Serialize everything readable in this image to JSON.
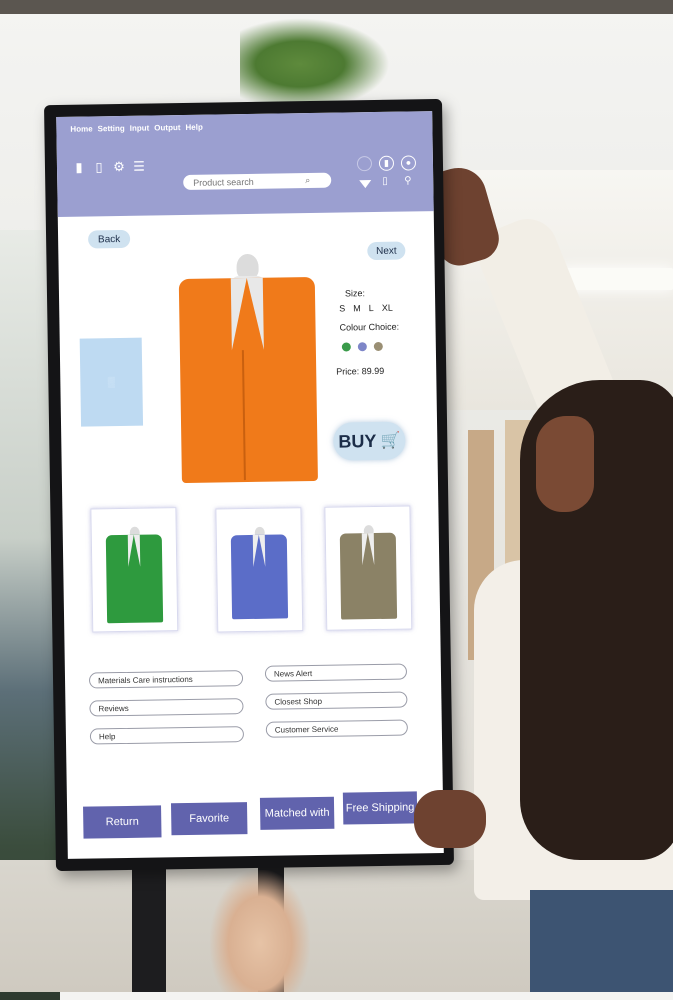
{
  "menu": [
    "Home",
    "Setting",
    "Input",
    "Output",
    "Help"
  ],
  "search": {
    "placeholder": "Product search",
    "icon": "search-icon"
  },
  "nav": {
    "back": "Back",
    "next": "Next"
  },
  "product": {
    "size_label": "Size:",
    "sizes": [
      "S",
      "M",
      "L",
      "XL"
    ],
    "colour_label": "Colour Choice:",
    "colours": [
      "#3a9b4a",
      "#7e86c8",
      "#9a8f74"
    ],
    "price": "Price: 89.99",
    "buy_label": "BUY",
    "main_color": "#f07a1a"
  },
  "thumbnails": [
    {
      "color": "#2e9a3e"
    },
    {
      "color": "#5b6dc8"
    },
    {
      "color": "#8b8266"
    }
  ],
  "links_left": [
    "Materials Care instructions",
    "Reviews",
    "Help"
  ],
  "links_right": [
    "News Alert",
    "Closest Shop",
    "Customer Service"
  ],
  "bottom_buttons": [
    "Return",
    "Favorite",
    "Matched with",
    "Free Shipping"
  ],
  "colors": {
    "header": "#9b9fd0",
    "button": "#6163ad",
    "pill": "#cfe2f0"
  }
}
